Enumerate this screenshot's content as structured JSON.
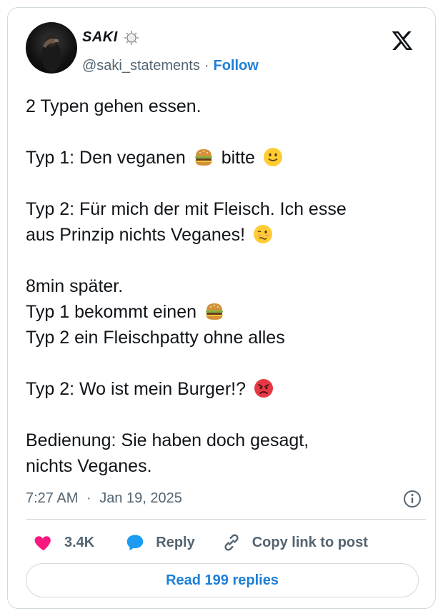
{
  "author": {
    "name": "SAKI",
    "handle": "@saki_statements",
    "separator": "·",
    "follow_label": "Follow",
    "badge_icon": "sparkle-badge-icon"
  },
  "tweet": {
    "lines": [
      "2 Typen gehen essen.",
      "Typ 1: Den veganen",
      "bitte",
      "Typ 2: Für mich der mit Fleisch. Ich esse",
      "aus Prinzip nichts Veganes!",
      "8min später.",
      "Typ 1 bekommt einen",
      "Typ 2 ein Fleischpatty ohne alles",
      "Typ 2: Wo ist mein Burger!?",
      "Bedienung: Sie haben doch gesagt,",
      "nichts Veganes."
    ],
    "emojis": [
      "burger",
      "slightly-smiling-face",
      "woozy-face",
      "burger",
      "angry-face"
    ]
  },
  "meta": {
    "time": "7:27 AM",
    "separator": "·",
    "date": "Jan 19, 2025"
  },
  "actions": {
    "like_count": "3.4K",
    "reply_label": "Reply",
    "copy_label": "Copy link to post"
  },
  "read_replies_label": "Read 199 replies",
  "colors": {
    "link_blue": "#1d7fd8",
    "like_pink": "#f91880",
    "reply_blue": "#1d9bf0",
    "muted": "#536471",
    "border": "#cfd9de"
  }
}
